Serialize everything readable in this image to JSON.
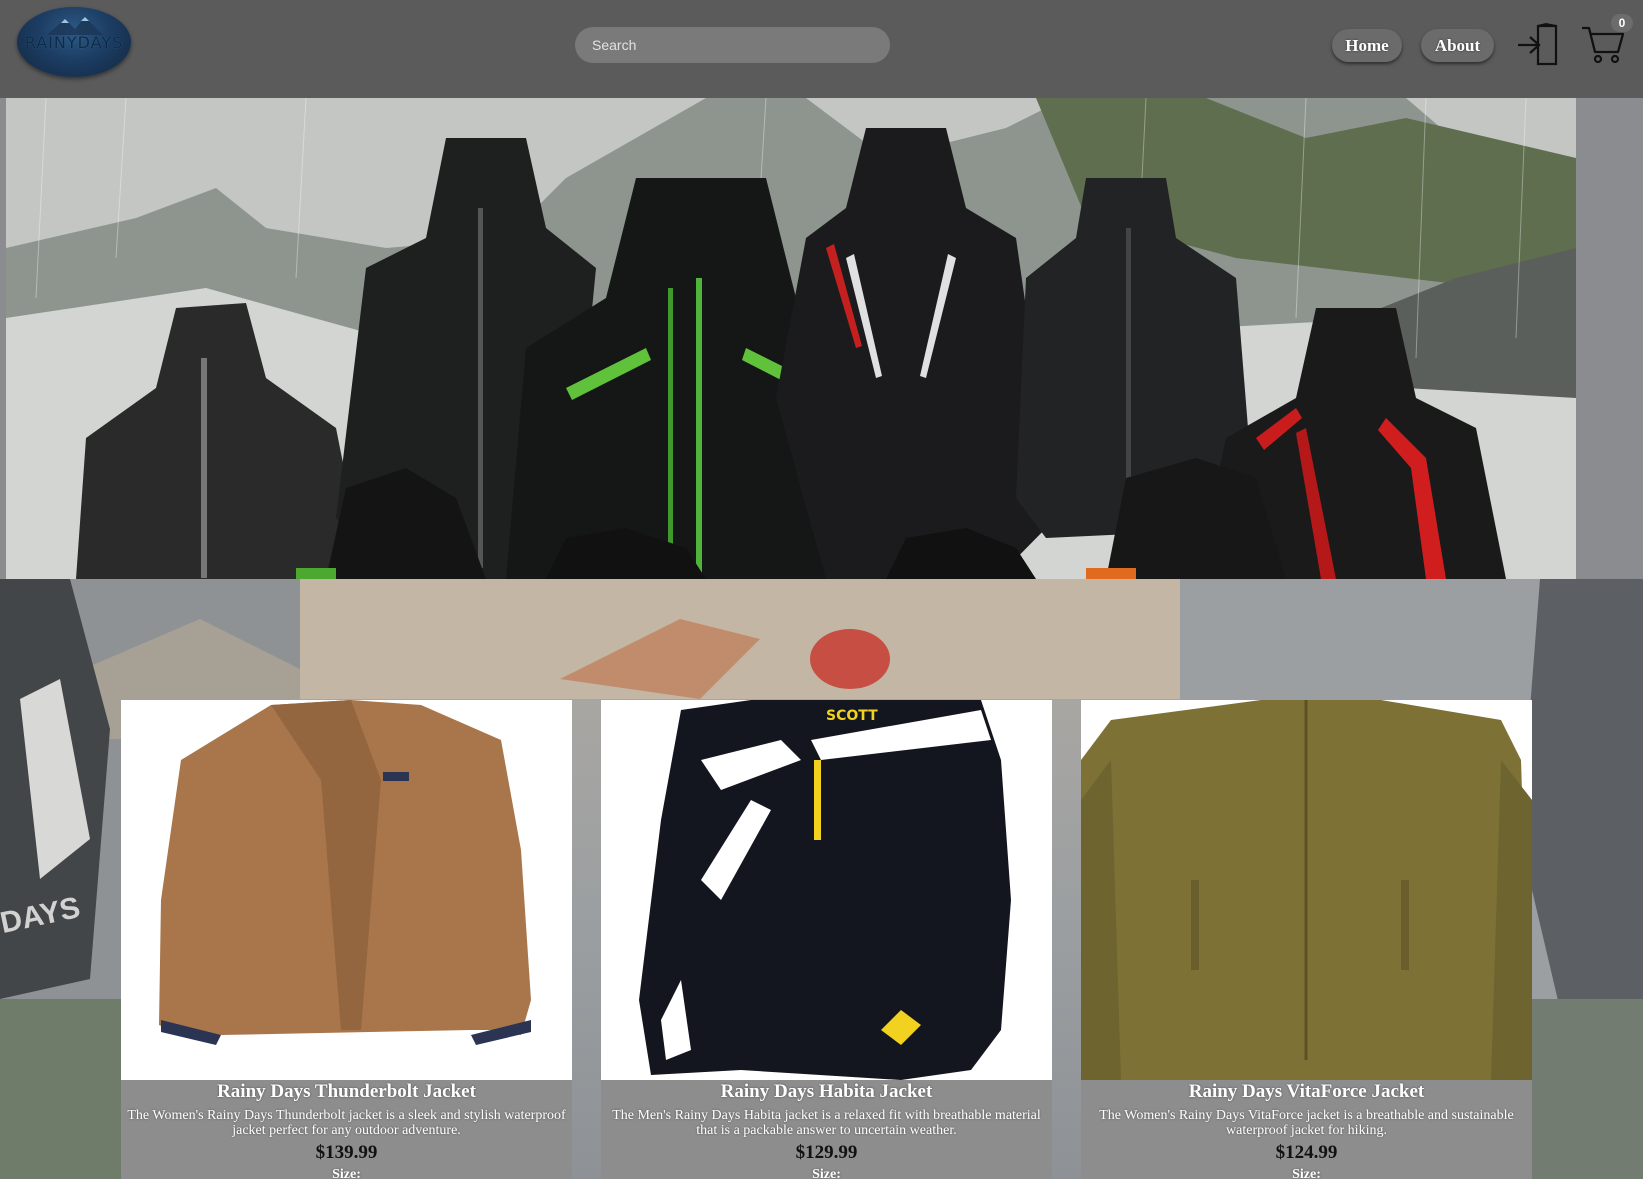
{
  "header": {
    "logo_text": "RAINYDAYS",
    "search": {
      "placeholder": "Search",
      "value": ""
    },
    "nav": {
      "home_label": "Home",
      "about_label": "About"
    },
    "login_icon": "login-door-icon",
    "cart_icon": "shopping-cart-icon",
    "cart_count": "0"
  },
  "hero": {
    "image": "rain-jackets-mountain-banner"
  },
  "background": {
    "brand_watermark": "DAYS"
  },
  "products": [
    {
      "title": "Rainy Days Thunderbolt Jacket",
      "description": "The Women's Rainy Days Thunderbolt jacket is a sleek and stylish waterproof jacket perfect for any outdoor adventure.",
      "price": "$139.99",
      "size_label": "Size:",
      "image_color": "#a8764a"
    },
    {
      "title": "Rainy Days Habita Jacket",
      "description": "The Men's Rainy Days Habita jacket is a relaxed fit with breathable material that is a packable answer to uncertain weather.",
      "price": "$129.99",
      "size_label": "Size:",
      "image_color": "#14161f"
    },
    {
      "title": "Rainy Days VitaForce Jacket",
      "description": "The Women's Rainy Days VitaForce jacket is a breathable and sustainable waterproof jacket for hiking.",
      "price": "$124.99",
      "size_label": "Size:",
      "image_color": "#7d7135"
    }
  ],
  "colors": {
    "header_bg": "#5b5b5c",
    "card_footer_bg": "#8d8d8e",
    "accent_green": "#5fc23a",
    "accent_red": "#d01e1e"
  }
}
